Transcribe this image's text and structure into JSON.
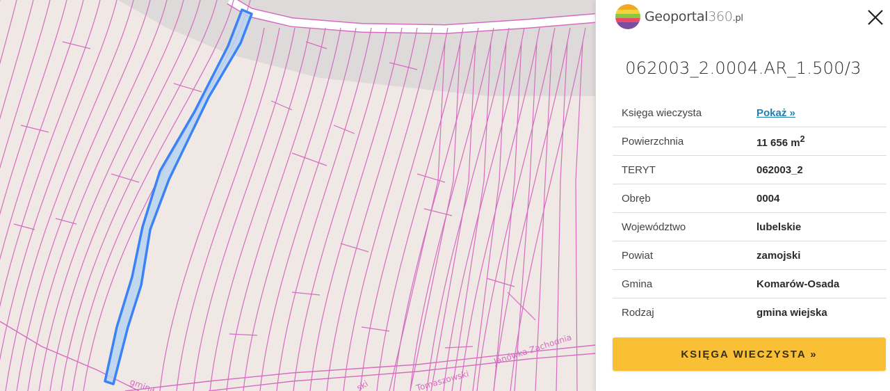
{
  "logo": {
    "name": "Geoportal",
    "num": "360",
    "tld": ".pl"
  },
  "parcel": {
    "id": "062003_2.0004.AR_1.500/3"
  },
  "info_rows": [
    {
      "key": "Księga wieczysta",
      "value": "Pokaż »",
      "is_link": true
    },
    {
      "key": "Powierzchnia",
      "value": "11 656 m",
      "sup": "2"
    },
    {
      "key": "TERYT",
      "value": "062003_2"
    },
    {
      "key": "Obręb",
      "value": "0004"
    },
    {
      "key": "Województwo",
      "value": "lubelskie"
    },
    {
      "key": "Powiat",
      "value": "zamojski"
    },
    {
      "key": "Gmina",
      "value": "Komarów-Osada"
    },
    {
      "key": "Rodzaj",
      "value": "gmina wiejska"
    }
  ],
  "kw_button": "KSIĘGA WIECZYSTA »",
  "map": {
    "road_labels": [
      "Janówka Zachodnia",
      "gmina",
      "ski",
      "Tomaszowski"
    ],
    "colors": {
      "parcel_line": "#d56cc0",
      "selected": "#3b82f6",
      "selected_fill": "#b9d3f0",
      "road_band": "#dedad9"
    }
  },
  "icons": {
    "close": "close-icon",
    "logo": "geoportal-logo-icon"
  }
}
